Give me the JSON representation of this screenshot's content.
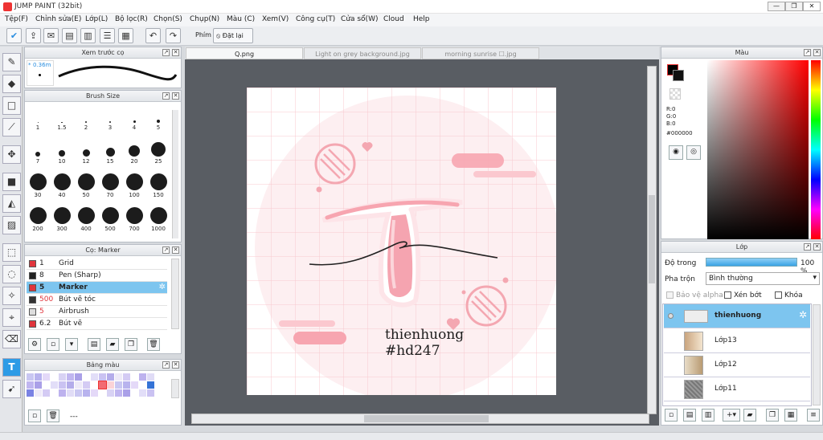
{
  "window": {
    "title": "JUMP PAINT (32bit)",
    "minimize": "—",
    "restore": "❐",
    "close": "✕"
  },
  "menu": [
    "Tệp(F)",
    "Chỉnh sửa(E)",
    "Lớp(L)",
    "Bộ lọc(R)",
    "Chọn(S)",
    "Chụp(N)",
    "Màu (C)",
    "Xem(V)",
    "Công cụ(T)",
    "Cửa sổ(W)",
    "Cloud",
    "Help"
  ],
  "toolbar": {
    "pen_label": "Phím",
    "reset_label": "Đặt lại"
  },
  "tabs": [
    "Q.png",
    "Light on grey background.jpg",
    "morning sunrise ☐.jpg"
  ],
  "brush_preview": {
    "title": "Xem trước cọ",
    "size": "0.36m",
    "star": "*"
  },
  "brush_size": {
    "title": "Brush Size",
    "sizes": [
      "1",
      "1.5",
      "2",
      "3",
      "4",
      "5",
      "7",
      "10",
      "12",
      "15",
      "20",
      "25",
      "30",
      "40",
      "50",
      "70",
      "100",
      "150",
      "200",
      "300",
      "400",
      "500",
      "700",
      "1000"
    ]
  },
  "brush_list": {
    "title": "Cọ: Marker",
    "items": [
      {
        "size": "1",
        "name": "Grid",
        "color": "#e0353c"
      },
      {
        "size": "8",
        "name": "Pen (Sharp)",
        "color": "#222222"
      },
      {
        "size": "5",
        "name": "Marker",
        "color": "#e0353c"
      },
      {
        "size": "500",
        "name": "Bút vẽ tóc",
        "color": "#333333"
      },
      {
        "size": "5",
        "name": "Airbrush",
        "color": "#e0353c"
      },
      {
        "size": "6.2",
        "name": "Bút vẽ",
        "color": "#e0353c"
      }
    ]
  },
  "palette": {
    "title": "Bảng màu",
    "extra": "---"
  },
  "color_panel": {
    "title": "Màu",
    "r": "R:0",
    "g": "G:0",
    "b": "B:0",
    "hex": "#000000"
  },
  "layer_panel": {
    "title": "Lớp",
    "opacity_label": "Độ trong",
    "opacity_value": "100 %",
    "opacity_level": 1.0,
    "blend_label": "Pha trộn",
    "blend_value": "Bình thường",
    "protect_alpha": "Bảo vệ alpha",
    "clip": "Xén bớt",
    "lock": "Khóa",
    "layers": [
      {
        "name": "thienhuong"
      },
      {
        "name": "Lớp13"
      },
      {
        "name": "Lớp12"
      },
      {
        "name": "Lớp11"
      }
    ]
  },
  "artwork": {
    "line1": "thienhuong",
    "line2": "#hd247",
    "accent": "#f7a5b0"
  }
}
